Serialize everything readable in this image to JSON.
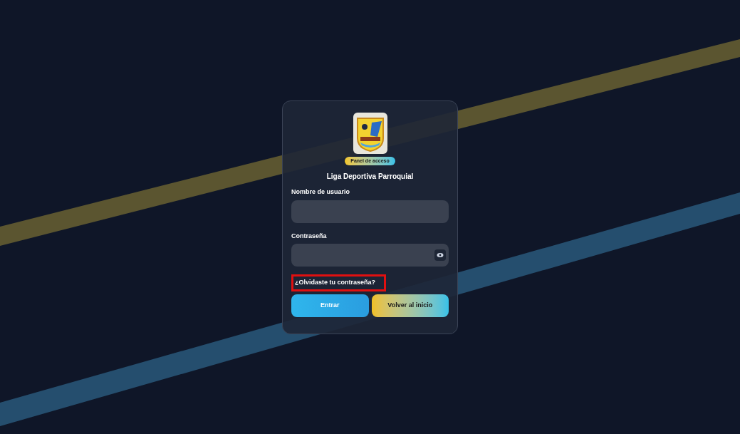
{
  "badge": "Panel de acceso",
  "title": "Liga Deportiva Parroquial",
  "fields": [
    {
      "label": "Nombre de usuario",
      "kind": "text"
    },
    {
      "label": "Contraseña",
      "kind": "password"
    }
  ],
  "forgot_link": {
    "text": "¿Olvidaste tu contraseña?",
    "highlighted": true
  },
  "buttons": [
    {
      "label": "Entrar",
      "kind": "primary"
    },
    {
      "label": "Volver al inicio",
      "kind": "secondary"
    }
  ]
}
